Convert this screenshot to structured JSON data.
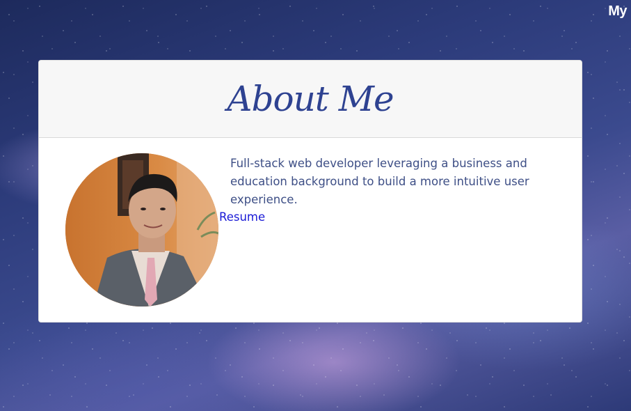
{
  "nav": {
    "brand": "My"
  },
  "about": {
    "title": "About Me",
    "bio": "Full-stack web developer leveraging a business and education background to build a more intuitive user experience.",
    "resume_label": "Resume",
    "photo_icon": "profile-photo"
  },
  "colors": {
    "title": "#2e4291",
    "bio_text": "#3e4f86",
    "link": "#1a1ad6",
    "card_header_bg": "#f7f7f7"
  }
}
